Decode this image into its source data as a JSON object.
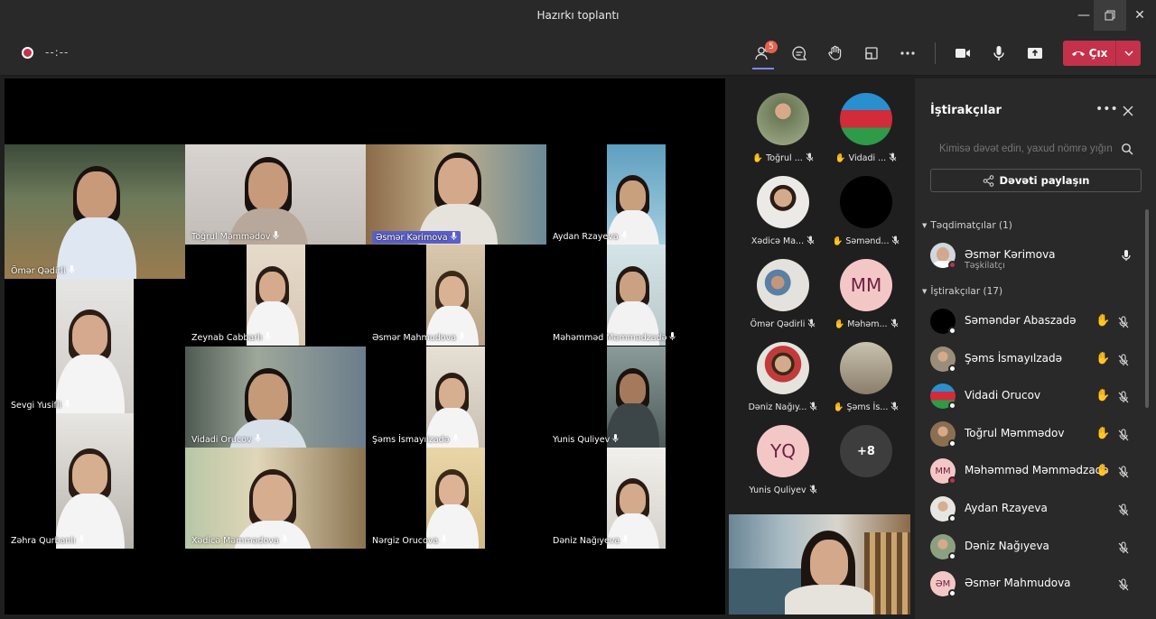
{
  "window": {
    "title": "Hazırkı toplantı"
  },
  "toolbar": {
    "timer": "--:--",
    "participants_badge": "5",
    "leave_label": "Çıx"
  },
  "stage": {
    "tiles": [
      {
        "name": "Ömər Qədirli"
      },
      {
        "name": "Toğrul Məmmədov"
      },
      {
        "name": "Əsmər Kərimova"
      },
      {
        "name": "Aydan Rzayeva"
      },
      {
        "name": "Zeynab Cabbarlı"
      },
      {
        "name": "Əsmər Mahmudova"
      },
      {
        "name": "Məhəmməd Məmmədzadə"
      },
      {
        "name": "Sevgi Yusifli"
      },
      {
        "name": "Vidadi Orucov"
      },
      {
        "name": "Şəms İsmayılzadə"
      },
      {
        "name": "Yunis Quliyev"
      },
      {
        "name": "Zəhra Qurbanlı"
      },
      {
        "name": "Xədicə Məmmədova"
      },
      {
        "name": "Nərgiz Orucova"
      },
      {
        "name": "Dəniz Nağıyeva"
      }
    ]
  },
  "strip": {
    "cards": [
      {
        "name": "Toğrul ...",
        "hand": "✋"
      },
      {
        "name": "Vidadi ...",
        "hand": "✋"
      },
      {
        "name": "Xədicə Ma...",
        "hand": ""
      },
      {
        "name": "Səmənd...",
        "hand": "✋"
      },
      {
        "name": "Ömər Qədirli",
        "hand": ""
      },
      {
        "name": "Məhəm...",
        "hand": "✋",
        "initials": "MM"
      },
      {
        "name": "Dəniz Nağıy...",
        "hand": ""
      },
      {
        "name": "Şəms İs...",
        "hand": "✋"
      },
      {
        "name": "Yunis Quliyev",
        "hand": "",
        "initials": "YQ"
      },
      {
        "name": "",
        "hand": "",
        "initials": "+8"
      }
    ]
  },
  "panel": {
    "title": "İştirakçılar",
    "search_placeholder": "Kimisə dəvət edin, yaxud nömrə yığın",
    "share_label": "Dəvəti paylaşın",
    "presenters_header": "Təqdimatçılar (1)",
    "presenter": {
      "name": "Əsmər Kərimova",
      "role": "Təşkilatçı"
    },
    "attendees_header": "İştirakçılar (17)",
    "attendees": [
      {
        "name": "Səməndər Abaszadə",
        "hand": "✋"
      },
      {
        "name": "Şəms İsmayılzadə",
        "hand": "✋"
      },
      {
        "name": "Vidadi Orucov",
        "hand": "✋"
      },
      {
        "name": "Toğrul Məmmədov",
        "hand": "✋"
      },
      {
        "name": "Məhəmməd Məmmədzadə",
        "hand": "✋",
        "initials": "MM"
      },
      {
        "name": "Aydan Rzayeva",
        "hand": ""
      },
      {
        "name": "Dəniz Nağıyeva",
        "hand": ""
      },
      {
        "name": "Əsmər Mahmudova",
        "hand": "",
        "initials": "ƏM"
      }
    ]
  },
  "colors": {
    "accent": "#5b5fc7",
    "leave": "#c4314b",
    "hand": "#ffb900",
    "panel": "#292929"
  }
}
